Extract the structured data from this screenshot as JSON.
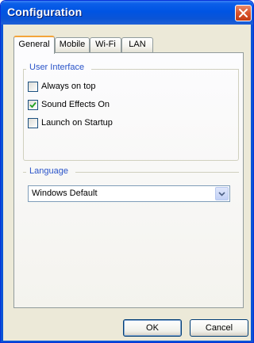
{
  "window": {
    "title": "Configuration"
  },
  "tabs": [
    {
      "label": "General",
      "active": true
    },
    {
      "label": "Mobile",
      "active": false
    },
    {
      "label": "Wi-Fi",
      "active": false
    },
    {
      "label": "LAN",
      "active": false
    }
  ],
  "user_interface": {
    "title": "User Interface",
    "options": [
      {
        "label": "Always on top",
        "checked": false
      },
      {
        "label": "Sound Effects On",
        "checked": true
      },
      {
        "label": "Launch on Startup",
        "checked": false
      }
    ]
  },
  "language": {
    "title": "Language",
    "selected": "Windows Default"
  },
  "buttons": {
    "ok": "OK",
    "cancel": "Cancel"
  },
  "colors": {
    "title_bar": "#0054e3",
    "group_title": "#2a54c9",
    "close_button": "#d9532b",
    "active_tab_accent": "#f3a43a"
  }
}
